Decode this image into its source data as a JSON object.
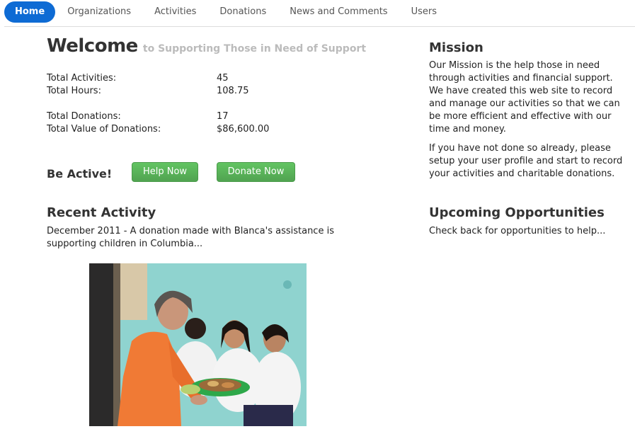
{
  "nav": {
    "items": [
      {
        "label": "Home",
        "active": true
      },
      {
        "label": "Organizations",
        "active": false
      },
      {
        "label": "Activities",
        "active": false
      },
      {
        "label": "Donations",
        "active": false
      },
      {
        "label": "News and Comments",
        "active": false
      },
      {
        "label": "Users",
        "active": false
      }
    ]
  },
  "welcome": {
    "title": "Welcome",
    "subtitle": "to Supporting Those in Need of Support"
  },
  "stats": {
    "total_activities_label": "Total Activities:",
    "total_activities_value": "45",
    "total_hours_label": "Total Hours:",
    "total_hours_value": "108.75",
    "total_donations_label": "Total Donations:",
    "total_donations_value": "17",
    "total_value_label": "Total Value of Donations:",
    "total_value_value": "$86,600.00"
  },
  "actions": {
    "be_active_label": "Be Active!",
    "help_label": "Help Now",
    "donate_label": "Donate Now"
  },
  "recent": {
    "title": "Recent Activity",
    "text": "December 2011 - A donation made with Blanca's assistance is supporting children in Columbia..."
  },
  "mission": {
    "title": "Mission",
    "p1": "Our Mission is the help those in need through activities and financial support. We have created this web site to record and manage our activities so that we can be more efficient and effective with our time and money.",
    "p2": "If you have not done so already, please setup your user profile and start to record your activities and charitable donations."
  },
  "upcoming": {
    "title": "Upcoming Opportunities",
    "text": "Check back for opportunities to help..."
  },
  "colors": {
    "accent": "#0e6bd4",
    "button_green": "#5cb85c",
    "subtitle_gray": "#bbbbbb"
  }
}
